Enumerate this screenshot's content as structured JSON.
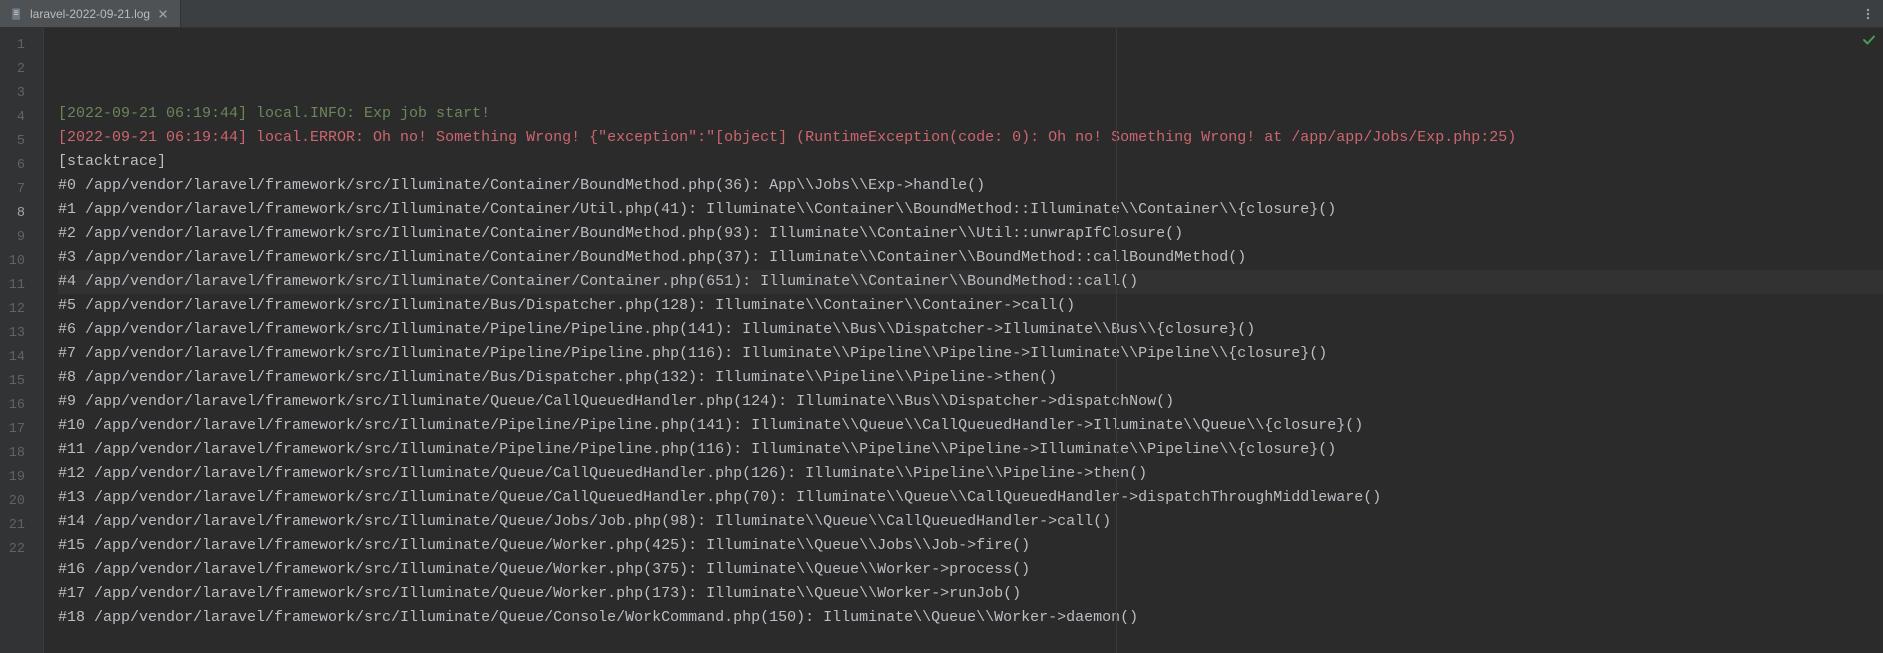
{
  "tab": {
    "filename": "laravel-2022-09-21.log"
  },
  "current_line_index": 7,
  "lines": [
    {
      "num": 1,
      "cls": "c-green",
      "text": "[2022-09-21 06:19:44] local.INFO: Exp job start!"
    },
    {
      "num": 2,
      "cls": "c-red",
      "text": "[2022-09-21 06:19:44] local.ERROR: Oh no! Something Wrong! {\"exception\":\"[object] (RuntimeException(code: 0): Oh no! Something Wrong! at /app/app/Jobs/Exp.php:25)"
    },
    {
      "num": 3,
      "cls": "",
      "text": "[stacktrace]"
    },
    {
      "num": 4,
      "cls": "",
      "text": "#0 /app/vendor/laravel/framework/src/Illuminate/Container/BoundMethod.php(36): App\\\\Jobs\\\\Exp->handle()"
    },
    {
      "num": 5,
      "cls": "",
      "text": "#1 /app/vendor/laravel/framework/src/Illuminate/Container/Util.php(41): Illuminate\\\\Container\\\\BoundMethod::Illuminate\\\\Container\\\\{closure}()"
    },
    {
      "num": 6,
      "cls": "",
      "text": "#2 /app/vendor/laravel/framework/src/Illuminate/Container/BoundMethod.php(93): Illuminate\\\\Container\\\\Util::unwrapIfClosure()"
    },
    {
      "num": 7,
      "cls": "",
      "text": "#3 /app/vendor/laravel/framework/src/Illuminate/Container/BoundMethod.php(37): Illuminate\\\\Container\\\\BoundMethod::callBoundMethod()"
    },
    {
      "num": 8,
      "cls": "",
      "text": "#4 /app/vendor/laravel/framework/src/Illuminate/Container/Container.php(651): Illuminate\\\\Container\\\\BoundMethod::call()"
    },
    {
      "num": 9,
      "cls": "",
      "text": "#5 /app/vendor/laravel/framework/src/Illuminate/Bus/Dispatcher.php(128): Illuminate\\\\Container\\\\Container->call()"
    },
    {
      "num": 10,
      "cls": "",
      "text": "#6 /app/vendor/laravel/framework/src/Illuminate/Pipeline/Pipeline.php(141): Illuminate\\\\Bus\\\\Dispatcher->Illuminate\\\\Bus\\\\{closure}()"
    },
    {
      "num": 11,
      "cls": "",
      "text": "#7 /app/vendor/laravel/framework/src/Illuminate/Pipeline/Pipeline.php(116): Illuminate\\\\Pipeline\\\\Pipeline->Illuminate\\\\Pipeline\\\\{closure}()"
    },
    {
      "num": 12,
      "cls": "",
      "text": "#8 /app/vendor/laravel/framework/src/Illuminate/Bus/Dispatcher.php(132): Illuminate\\\\Pipeline\\\\Pipeline->then()"
    },
    {
      "num": 13,
      "cls": "",
      "text": "#9 /app/vendor/laravel/framework/src/Illuminate/Queue/CallQueuedHandler.php(124): Illuminate\\\\Bus\\\\Dispatcher->dispatchNow()"
    },
    {
      "num": 14,
      "cls": "",
      "text": "#10 /app/vendor/laravel/framework/src/Illuminate/Pipeline/Pipeline.php(141): Illuminate\\\\Queue\\\\CallQueuedHandler->Illuminate\\\\Queue\\\\{closure}()"
    },
    {
      "num": 15,
      "cls": "",
      "text": "#11 /app/vendor/laravel/framework/src/Illuminate/Pipeline/Pipeline.php(116): Illuminate\\\\Pipeline\\\\Pipeline->Illuminate\\\\Pipeline\\\\{closure}()"
    },
    {
      "num": 16,
      "cls": "",
      "text": "#12 /app/vendor/laravel/framework/src/Illuminate/Queue/CallQueuedHandler.php(126): Illuminate\\\\Pipeline\\\\Pipeline->then()"
    },
    {
      "num": 17,
      "cls": "",
      "text": "#13 /app/vendor/laravel/framework/src/Illuminate/Queue/CallQueuedHandler.php(70): Illuminate\\\\Queue\\\\CallQueuedHandler->dispatchThroughMiddleware()"
    },
    {
      "num": 18,
      "cls": "",
      "text": "#14 /app/vendor/laravel/framework/src/Illuminate/Queue/Jobs/Job.php(98): Illuminate\\\\Queue\\\\CallQueuedHandler->call()"
    },
    {
      "num": 19,
      "cls": "",
      "text": "#15 /app/vendor/laravel/framework/src/Illuminate/Queue/Worker.php(425): Illuminate\\\\Queue\\\\Jobs\\\\Job->fire()"
    },
    {
      "num": 20,
      "cls": "",
      "text": "#16 /app/vendor/laravel/framework/src/Illuminate/Queue/Worker.php(375): Illuminate\\\\Queue\\\\Worker->process()"
    },
    {
      "num": 21,
      "cls": "",
      "text": "#17 /app/vendor/laravel/framework/src/Illuminate/Queue/Worker.php(173): Illuminate\\\\Queue\\\\Worker->runJob()"
    },
    {
      "num": 22,
      "cls": "",
      "text": "#18 /app/vendor/laravel/framework/src/Illuminate/Queue/Console/WorkCommand.php(150): Illuminate\\\\Queue\\\\Worker->daemon()"
    }
  ]
}
